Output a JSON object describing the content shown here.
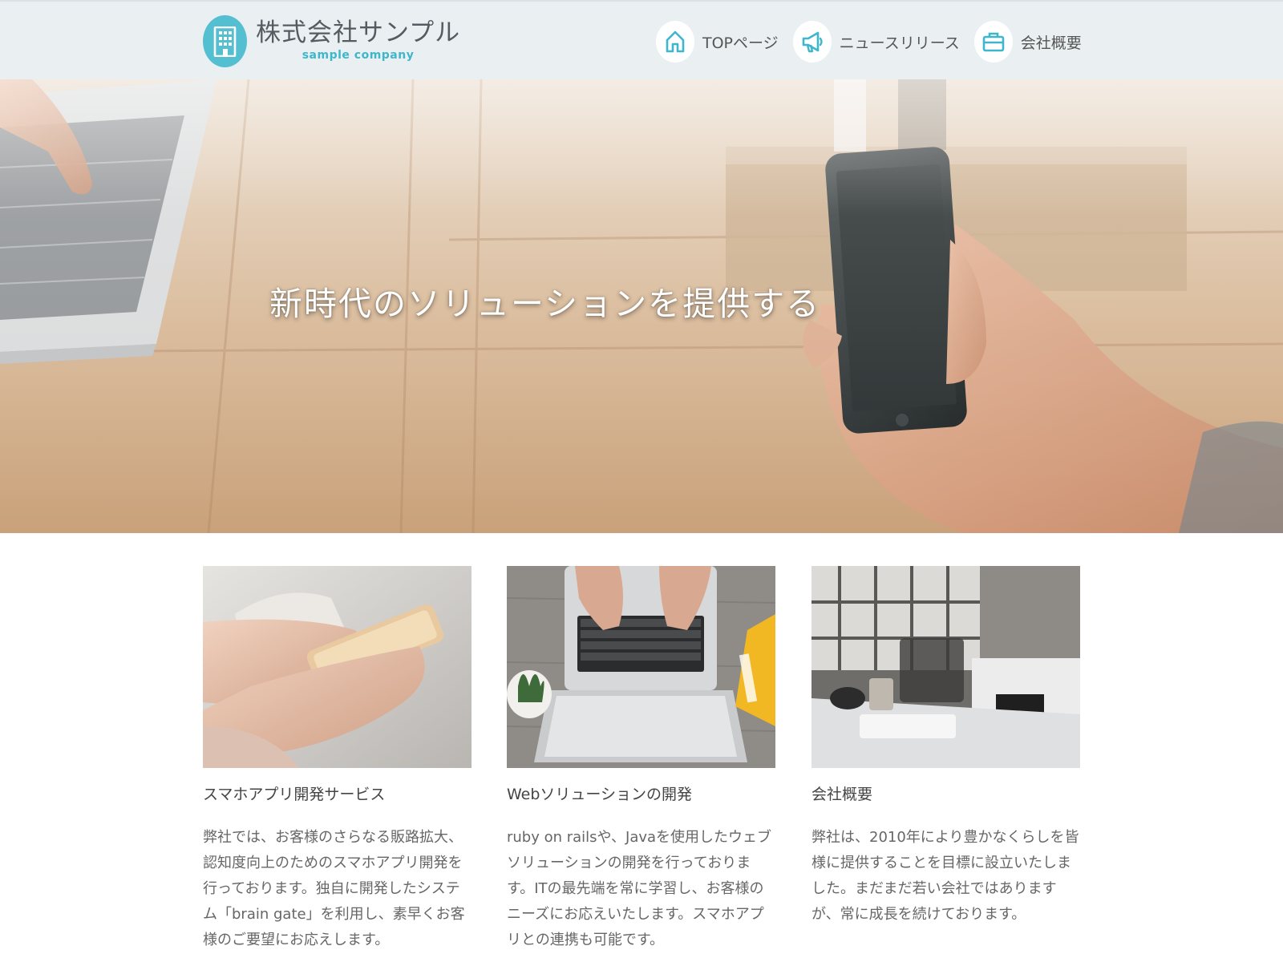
{
  "header": {
    "logo": {
      "name_jp": "株式会社サンプル",
      "name_en": "sample company",
      "icon": "building-icon"
    },
    "nav": [
      {
        "label": "TOPページ",
        "icon": "home-icon"
      },
      {
        "label": "ニュースリリース",
        "icon": "megaphone-icon"
      },
      {
        "label": "会社概要",
        "icon": "briefcase-icon"
      }
    ]
  },
  "hero": {
    "title": "新時代のソリューションを提供する"
  },
  "cards": [
    {
      "title": "スマホアプリ開発サービス",
      "text": "弊社では、お客様のさらなる販路拡大、認知度向上のためのスマホアプリ開発を行っております。独自に開発したシステム「brain gate」を利用し、素早くお客様のご要望にお応えします。"
    },
    {
      "title": "Webソリューションの開発",
      "text": "ruby on railsや、Javaを使用したウェブソリューションの開発を行っております。ITの最先端を常に学習し、お客様のニーズにお応えいたします。スマホアプリとの連携も可能です。"
    },
    {
      "title": "会社概要",
      "text": "弊社は、2010年により豊かなくらしを皆様に提供することを目標に設立いたしました。まだまだ若い会社ではありますが、常に成長を続けております。"
    }
  ],
  "colors": {
    "accent": "#55bfd2",
    "header_bg": "#eaf0f2",
    "text": "#444444"
  }
}
